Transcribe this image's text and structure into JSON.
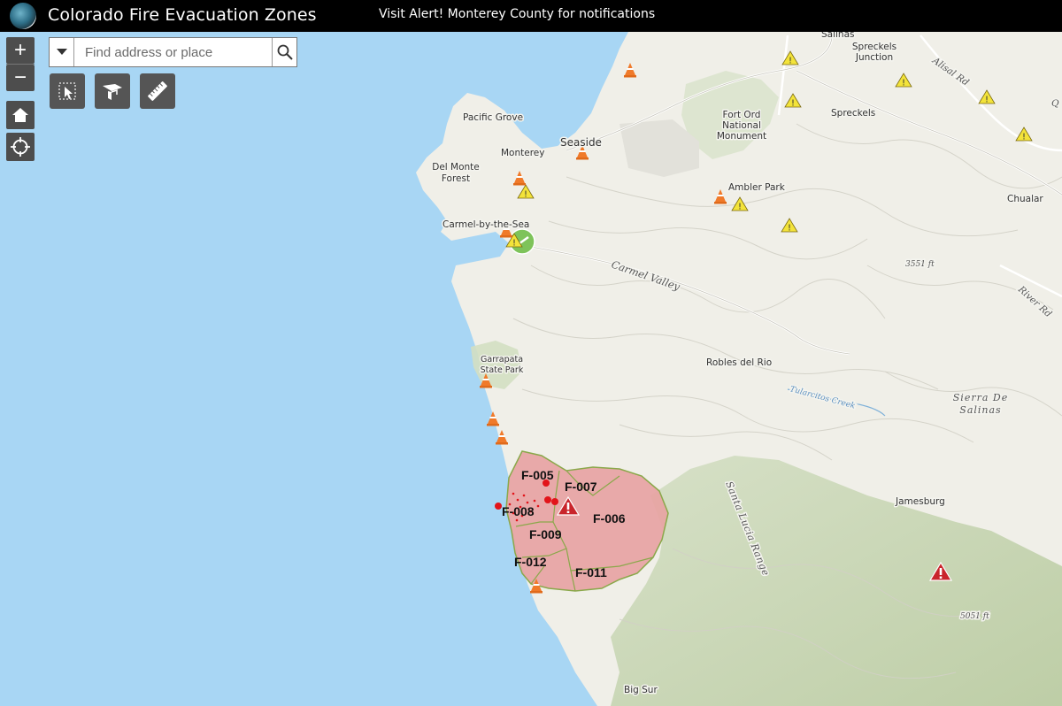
{
  "header": {
    "title": "Colorado Fire Evacuation Zones",
    "banner": "Visit Alert! Monterey County for notifications"
  },
  "search": {
    "placeholder": "Find address or place"
  },
  "controls": {
    "zoom_in": "+",
    "zoom_out": "−"
  },
  "icons": {
    "logo": "county-seal-icon",
    "home": "home-icon",
    "locate": "locate-icon",
    "search": "search-icon",
    "dropdown": "chevron-down-icon",
    "tool1": "select-features-icon",
    "tool2": "measure-area-icon",
    "tool3": "ruler-icon"
  },
  "colors": {
    "water": "#a8d6f4",
    "land": "#f1f0ea",
    "forest": "#c9d8b8",
    "zone_fill": "#e7a3a3",
    "zone_stroke": "#8aa84a",
    "alert_red": "#c9252b",
    "warning_yellow": "#f3e33a"
  },
  "places": {
    "salinas": "Salinas",
    "spreckels_junction": "Spreckels\nJunction",
    "spreckels": "Spreckels",
    "alisal_rd": "Alisal Rd",
    "pacific_grove": "Pacific Grove",
    "fort_ord": "Fort Ord\nNational\nMonument",
    "seaside": "Seaside",
    "monterey": "Monterey",
    "del_monte": "Del Monte\nForest",
    "ambler_park": "Ambler Park",
    "chualar": "Chualar",
    "carmel": "Carmel-by-the-Sea",
    "carmel_valley": "Carmel Valley",
    "elev_3551": "3551 ft",
    "river_rd": "River Rd",
    "garrapata": "Garrapata\nState Park",
    "robles": "Robles del Rio",
    "tularcitos": "Tularcitos Creek",
    "sierra_salinas": "Sierra De\nSalinas",
    "jamesburg": "Jamesburg",
    "santa_lucia": "Santa Lucia Range",
    "elev_5051": "5051 ft",
    "big_sur": "Big Sur",
    "q": "Q"
  },
  "zones": [
    "F-005",
    "F-007",
    "F-006",
    "F-008",
    "F-009",
    "F-012",
    "F-011"
  ]
}
